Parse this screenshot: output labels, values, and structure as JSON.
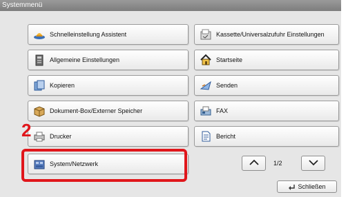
{
  "window": {
    "title": "Systemmenü"
  },
  "menu": {
    "items": [
      {
        "label": "Schnelleinstellung Assistent",
        "icon": "hat-icon"
      },
      {
        "label": "Kassette/Universalzufuhr Einstellungen",
        "icon": "paper-tray-icon"
      },
      {
        "label": "Allgemeine Einstellungen",
        "icon": "printer-settings-icon"
      },
      {
        "label": "Startseite",
        "icon": "home-icon"
      },
      {
        "label": "Kopieren",
        "icon": "copy-icon"
      },
      {
        "label": "Senden",
        "icon": "send-icon"
      },
      {
        "label": "Dokument-Box/Externer Speicher",
        "icon": "document-box-icon"
      },
      {
        "label": "FAX",
        "icon": "fax-icon"
      },
      {
        "label": "Drucker",
        "icon": "printer-icon"
      },
      {
        "label": "Bericht",
        "icon": "report-icon"
      },
      {
        "label": "System/Netzwerk",
        "icon": "system-network-icon"
      }
    ]
  },
  "pagination": {
    "current": "1/2",
    "up_icon": "chevron-up-icon",
    "down_icon": "chevron-down-icon"
  },
  "close_button": {
    "label": "Schließen",
    "icon": "return-icon"
  },
  "annotation": {
    "step_number": "2",
    "highlight_color": "#e0161b"
  }
}
